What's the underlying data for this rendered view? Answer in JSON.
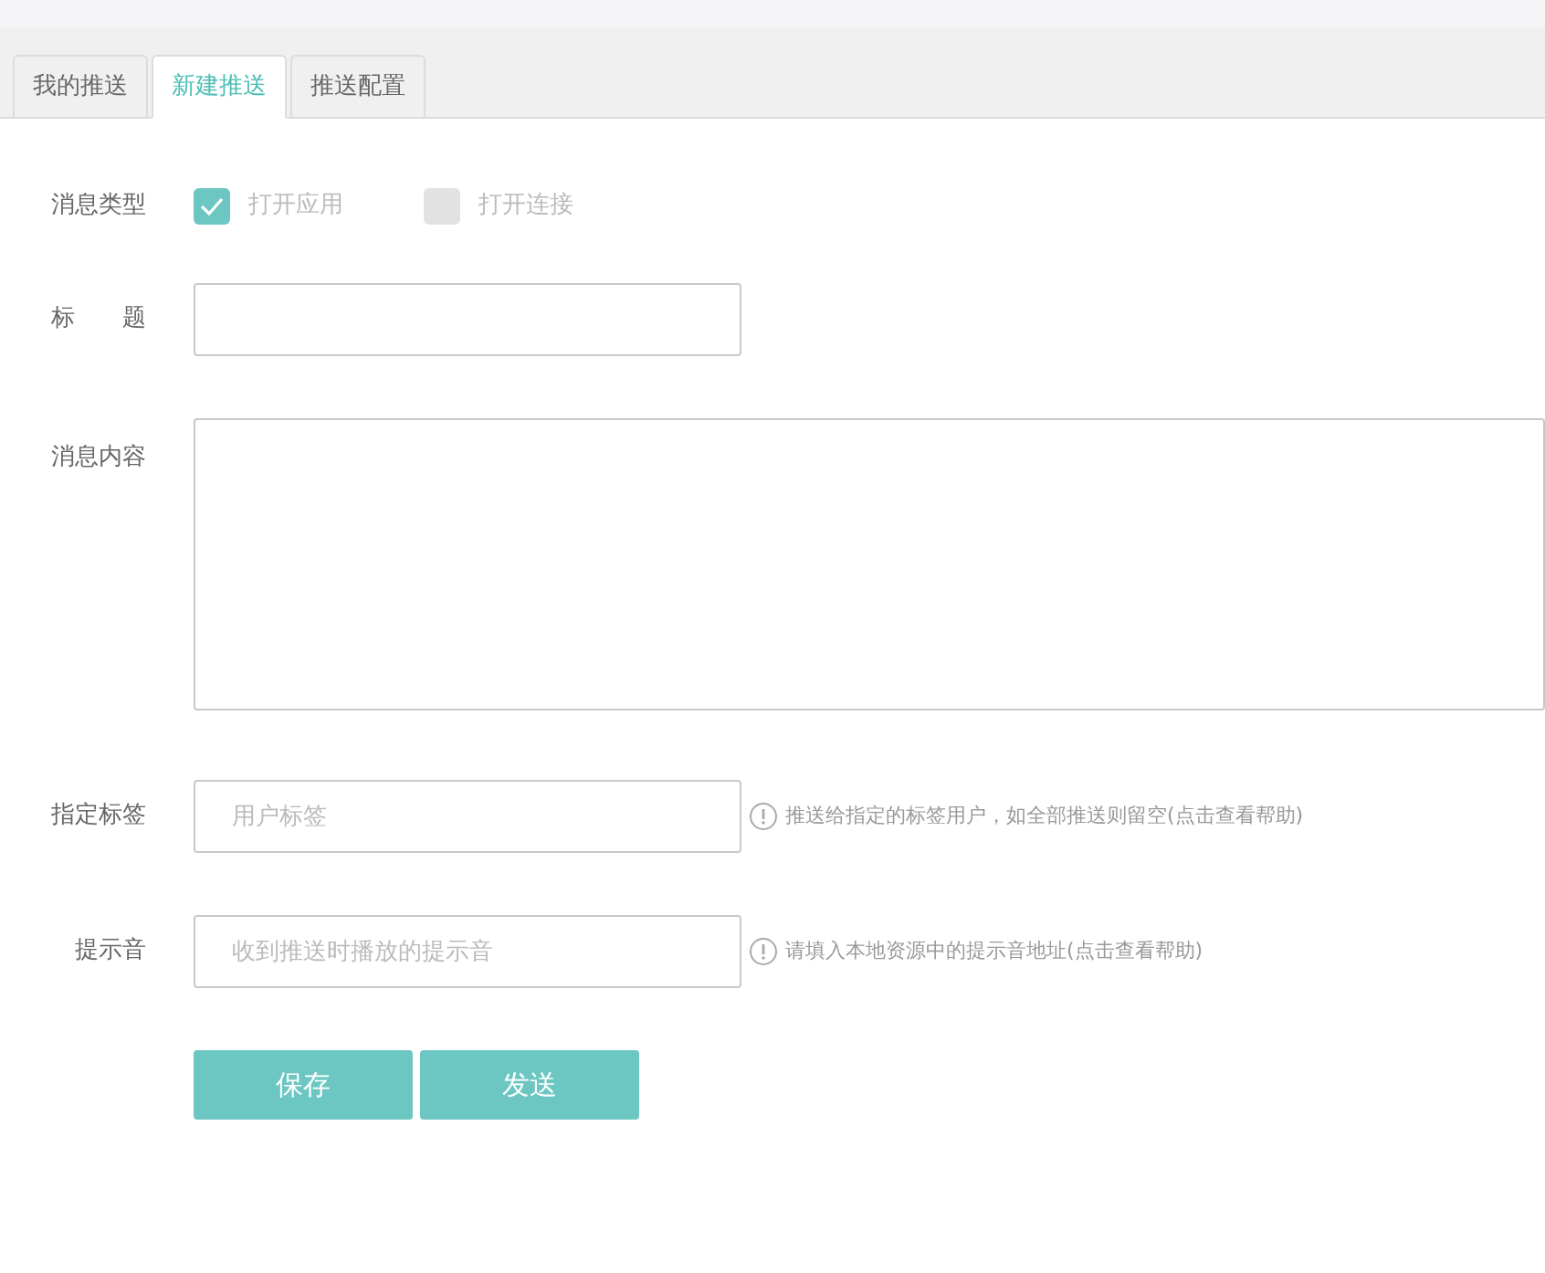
{
  "tabs": [
    {
      "label": "我的推送",
      "selected": false
    },
    {
      "label": "新建推送",
      "selected": true
    },
    {
      "label": "推送配置",
      "selected": false
    }
  ],
  "form": {
    "message_type": {
      "label": "消息类型",
      "options": [
        {
          "label": "打开应用",
          "checked": true
        },
        {
          "label": "打开连接",
          "checked": false
        }
      ]
    },
    "title": {
      "label": "标　　题"
    },
    "content": {
      "label": "消息内容"
    },
    "tag": {
      "label": "指定标签",
      "placeholder": "用户标签",
      "hint": "推送给指定的标签用户，如全部推送则留空(点击查看帮助)"
    },
    "sound": {
      "label": "提示音",
      "placeholder": "收到推送时播放的提示音",
      "hint": "请填入本地资源中的提示音地址(点击查看帮助)"
    }
  },
  "buttons": [
    "保存",
    "发送"
  ]
}
